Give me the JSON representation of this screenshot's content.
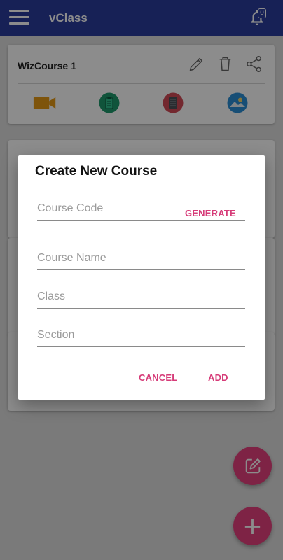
{
  "app": {
    "title": "vClass",
    "notification_count": "0"
  },
  "courses": [
    {
      "title": "WizCourse 1",
      "features": [
        "video-camera-icon",
        "clipboard-icon",
        "notebook-icon",
        "gallery-icon"
      ]
    }
  ],
  "colors": {
    "appbar": "#2b3c9d",
    "accent": "#e6417e",
    "dialog_button": "#d63b78"
  },
  "dialog": {
    "title": "Create New Course",
    "course_code_placeholder": "Course Code",
    "generate_label": "GENERATE",
    "course_name_placeholder": "Course Name",
    "class_placeholder": "Class",
    "section_placeholder": "Section",
    "cancel_label": "CANCEL",
    "add_label": "ADD"
  },
  "fab": {
    "add_symbol": "+"
  }
}
